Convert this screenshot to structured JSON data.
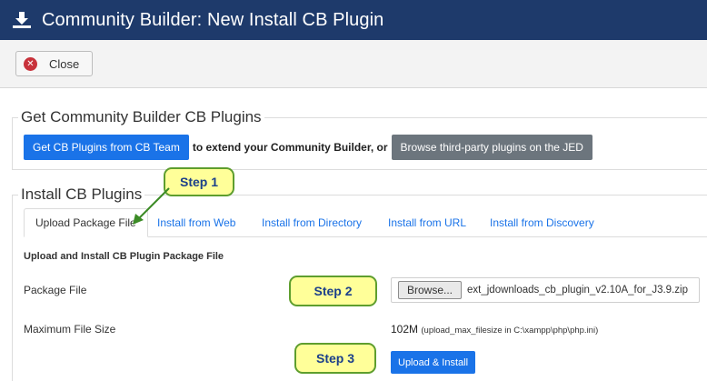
{
  "header": {
    "title": "Community Builder: New Install CB Plugin",
    "icon": "download-icon",
    "bg_color": "#1e3a6b"
  },
  "toolbar": {
    "close_label": "Close",
    "close_icon": "close-circle-icon"
  },
  "get_plugins": {
    "legend": "Get Community Builder CB Plugins",
    "cb_team_button": "Get CB Plugins from CB Team",
    "connector_text": "to extend your Community Builder, or",
    "jed_button": "Browse third-party plugins on the JED"
  },
  "install": {
    "legend": "Install CB Plugins",
    "tabs": [
      {
        "label": "Upload Package File",
        "active": true
      },
      {
        "label": "Install from Web",
        "active": false
      },
      {
        "label": "Install from Directory",
        "active": false
      },
      {
        "label": "Install from URL",
        "active": false
      },
      {
        "label": "Install from Discovery",
        "active": false
      }
    ],
    "section_title": "Upload and Install CB Plugin Package File",
    "package_file_label": "Package File",
    "browse_label": "Browse...",
    "file_name": "ext_jdownloads_cb_plugin_v2.10A_for_J3.9.zip",
    "max_size_label": "Maximum File Size",
    "max_size_value": "102M",
    "max_size_note": "(upload_max_filesize in C:\\xampp\\php\\php.ini)",
    "upload_button": "Upload & Install"
  },
  "callouts": {
    "step1": "Step 1",
    "step2": "Step 2",
    "step3": "Step 3"
  },
  "colors": {
    "primary_button": "#1a73e8",
    "secondary_button": "#6c757d",
    "callout_fill": "#ffff99",
    "callout_border": "#5e9e2e",
    "callout_text": "#1b3f8a"
  }
}
